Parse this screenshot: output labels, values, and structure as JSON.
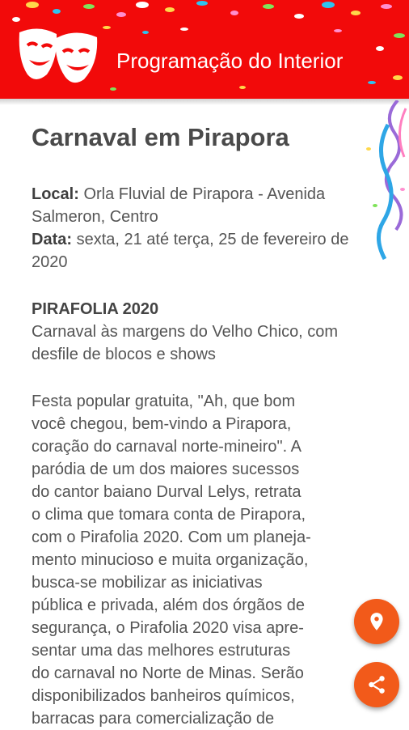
{
  "header": {
    "app_title": "Programação do Interior",
    "logo_icon": "theater-masks-icon",
    "background": "#f20a0a"
  },
  "event": {
    "title": "Carnaval em Pirapora",
    "local_label": "Local:",
    "local_value": "Orla Fluvial de Pirapora - Avenida Salmeron, Centro",
    "date_label": "Data:",
    "date_value": "sexta, 21 até terça, 25 de fevereiro de 2020",
    "subtitle": "PIRAFOLIA 2020",
    "subtitle_desc": "Carnaval às margens do Velho Chico, com desfile de blocos e shows",
    "description": "Festa popular gratuita, \"Ah, que bom\nvocê chegou, bem-vindo a Pirapora,\ncoração do carnaval norte-mineiro\". A\nparódia de um dos maiores sucessos\ndo cantor baiano Durval Lelys, retrata\no clima que tomara conta de Pirapora,\ncom o Pirafolia 2020. Com um planeja-\nmento minucioso e muita organização,\nbusca-se mobilizar as iniciativas\npública e privada, além dos órgãos de\nsegurança, o Pirafolia 2020 visa apre-\nsentar uma das melhores estruturas\ndo carnaval no Norte de Minas. Serão\ndisponibilizados banheiros químicos,\nbarracas para comercialização de"
  },
  "fabs": {
    "location_icon": "location-pin-icon",
    "share_icon": "share-icon",
    "color": "#f25a1a"
  }
}
